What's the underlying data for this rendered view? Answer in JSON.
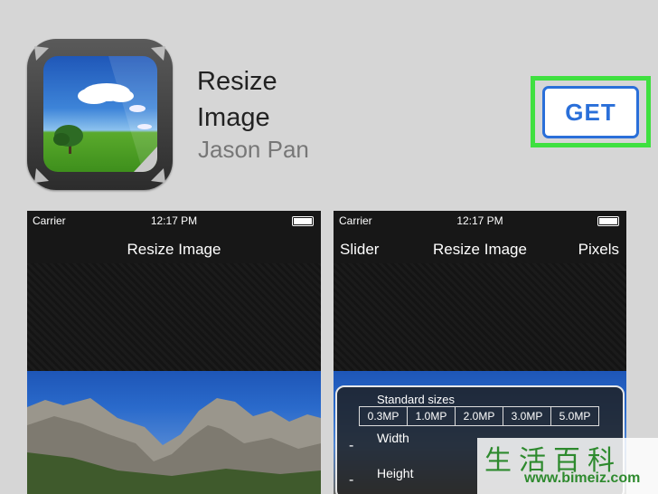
{
  "app": {
    "name": "Resize\nImage",
    "developer": "Jason Pan",
    "get_label": "GET"
  },
  "screenshots": [
    {
      "status": {
        "carrier": "Carrier",
        "time": "12:17 PM"
      },
      "navbar": {
        "title": "Resize Image"
      }
    },
    {
      "status": {
        "carrier": "Carrier",
        "time": "12:17 PM"
      },
      "navbar": {
        "left": "Slider",
        "title": "Resize Image",
        "right": "Pixels"
      },
      "panel": {
        "standard_sizes_label": "Standard sizes",
        "sizes": [
          "0.3MP",
          "1.0MP",
          "2.0MP",
          "3.0MP",
          "5.0MP"
        ],
        "width_label": "Width",
        "height_label": "Height",
        "minus": "-"
      }
    }
  ],
  "watermark": {
    "chars": "生活百科",
    "url": "www.bimeiz.com"
  },
  "colors": {
    "accent": "#2a6fd9",
    "highlight": "#3fe040",
    "background": "#d6d6d6"
  }
}
